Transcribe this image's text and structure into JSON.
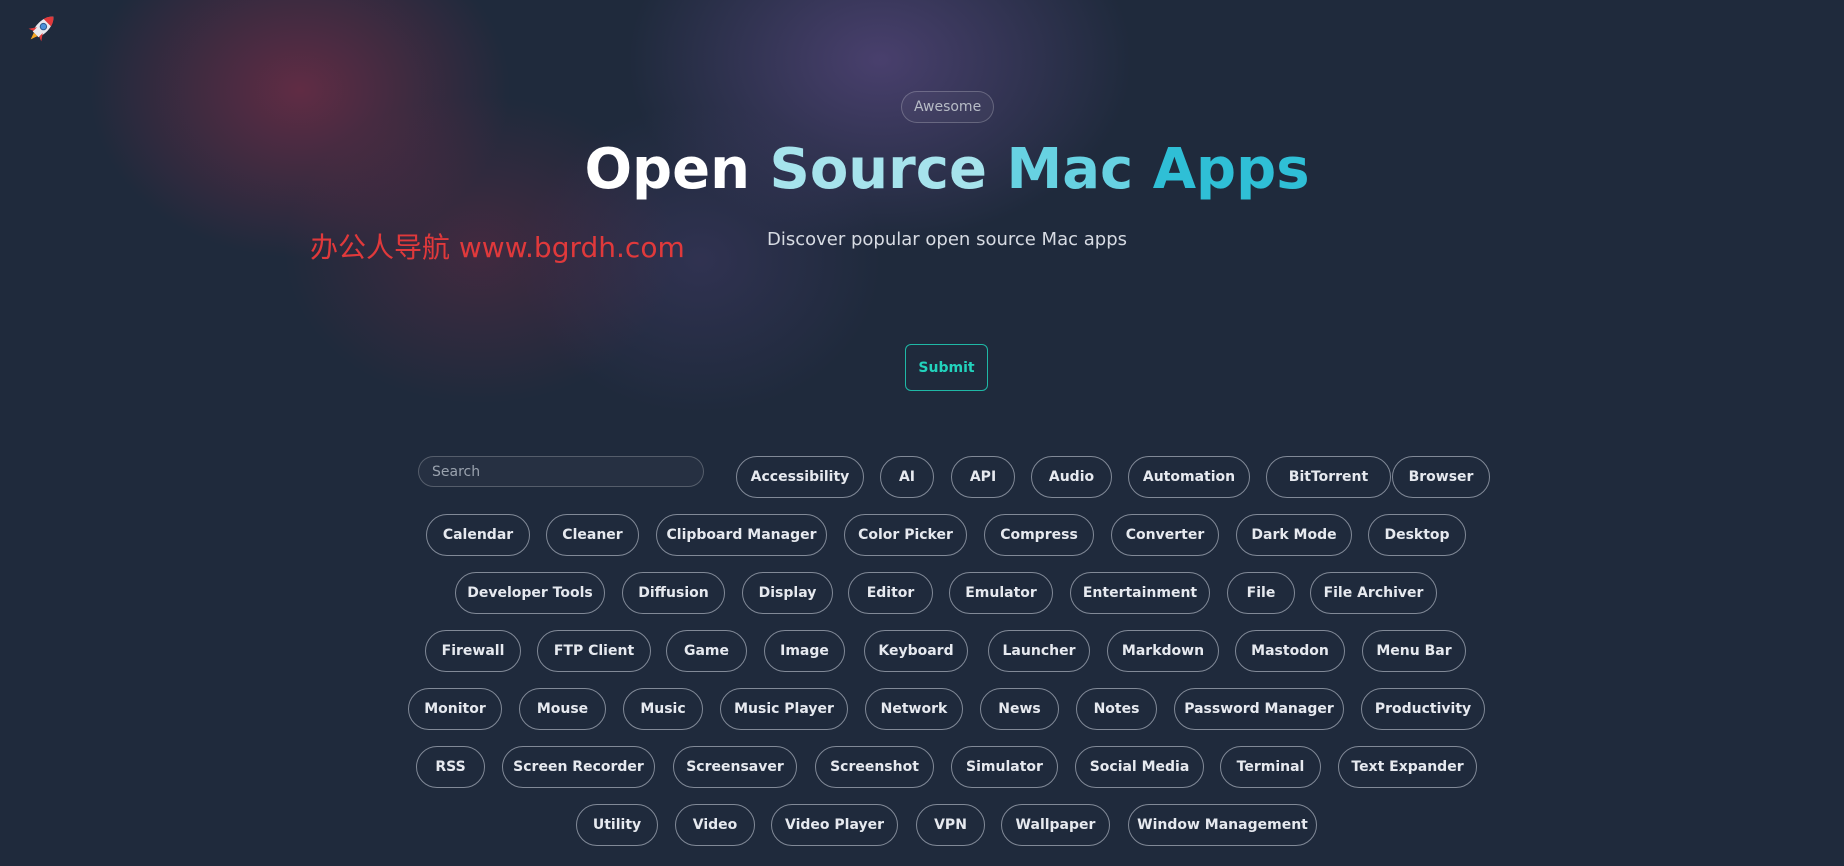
{
  "header": {
    "logo_icon": "rocket-icon",
    "badge": "Awesome",
    "title_words": [
      "Open",
      "Source",
      "Mac",
      "Apps"
    ],
    "subtitle": "Discover popular open source Mac apps",
    "watermark": "办公人导航  www.bgrdh.com",
    "submit_label": "Submit"
  },
  "search": {
    "placeholder": "Search"
  },
  "tags": [
    "Accessibility",
    "AI",
    "API",
    "Audio",
    "Automation",
    "BitTorrent",
    "Browser",
    "Calendar",
    "Cleaner",
    "Clipboard Manager",
    "Color Picker",
    "Compress",
    "Converter",
    "Dark Mode",
    "Desktop",
    "Developer Tools",
    "Diffusion",
    "Display",
    "Editor",
    "Emulator",
    "Entertainment",
    "File",
    "File Archiver",
    "Firewall",
    "FTP Client",
    "Game",
    "Image",
    "Keyboard",
    "Launcher",
    "Markdown",
    "Mastodon",
    "Menu Bar",
    "Monitor",
    "Mouse",
    "Music",
    "Music Player",
    "Network",
    "News",
    "Notes",
    "Password Manager",
    "Productivity",
    "RSS",
    "Screen Recorder",
    "Screensaver",
    "Screenshot",
    "Simulator",
    "Social Media",
    "Terminal",
    "Text Expander",
    "Utility",
    "Video",
    "Video Player",
    "VPN",
    "Wallpaper",
    "Window Management"
  ],
  "colors": {
    "background": "#1f2a3c",
    "accent": "#22d3bd",
    "title_gradient": [
      "#ffffff",
      "#a6e3ec",
      "#67d2e2",
      "#2fbfd6"
    ],
    "watermark": "#e0393b"
  }
}
